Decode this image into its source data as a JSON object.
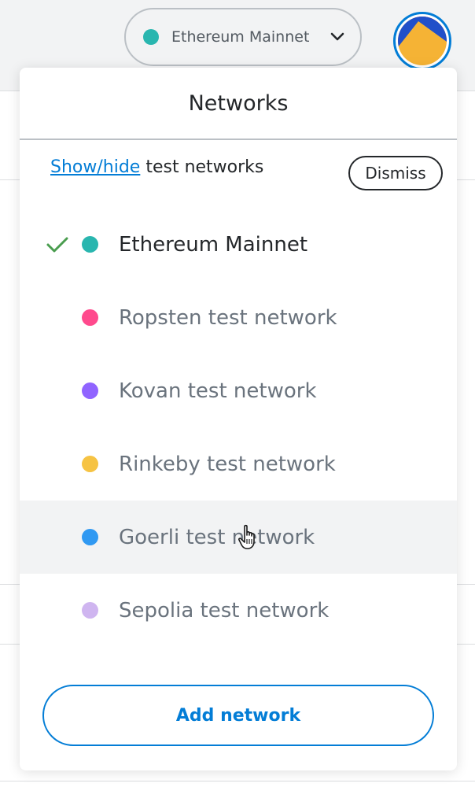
{
  "header": {
    "network_selector": {
      "label": "Ethereum Mainnet",
      "dot_color": "#29b6af",
      "icon": "chevron-down-icon"
    },
    "account_avatar": {
      "icon": "account-jazzicon",
      "colors": [
        "#f5b335",
        "#2150c9",
        "#e42e40"
      ],
      "ring_color": "#037dd6"
    }
  },
  "networks_menu": {
    "title": "Networks",
    "notice": {
      "link_text": "Show/hide",
      "text": " test networks",
      "dismiss_label": "Dismiss"
    },
    "items": [
      {
        "label": "Ethereum Mainnet",
        "color": "#29b6af",
        "selected": true,
        "icon": "check-icon"
      },
      {
        "label": "Ropsten test network",
        "color": "#ff4a8d",
        "selected": false
      },
      {
        "label": "Kovan test network",
        "color": "#9064ff",
        "selected": false
      },
      {
        "label": "Rinkeby test network",
        "color": "#f6c343",
        "selected": false
      },
      {
        "label": "Goerli test network",
        "color": "#3099f2",
        "selected": false,
        "hovered": true
      },
      {
        "label": "Sepolia test network",
        "color": "#cfb5f0",
        "selected": false
      }
    ],
    "add_network_label": "Add network"
  },
  "colors": {
    "accent": "#037dd6",
    "check": "#4a9d4f",
    "text_primary": "#24272a",
    "text_secondary": "#6a737d"
  },
  "cursor": "hand-pointer-icon"
}
